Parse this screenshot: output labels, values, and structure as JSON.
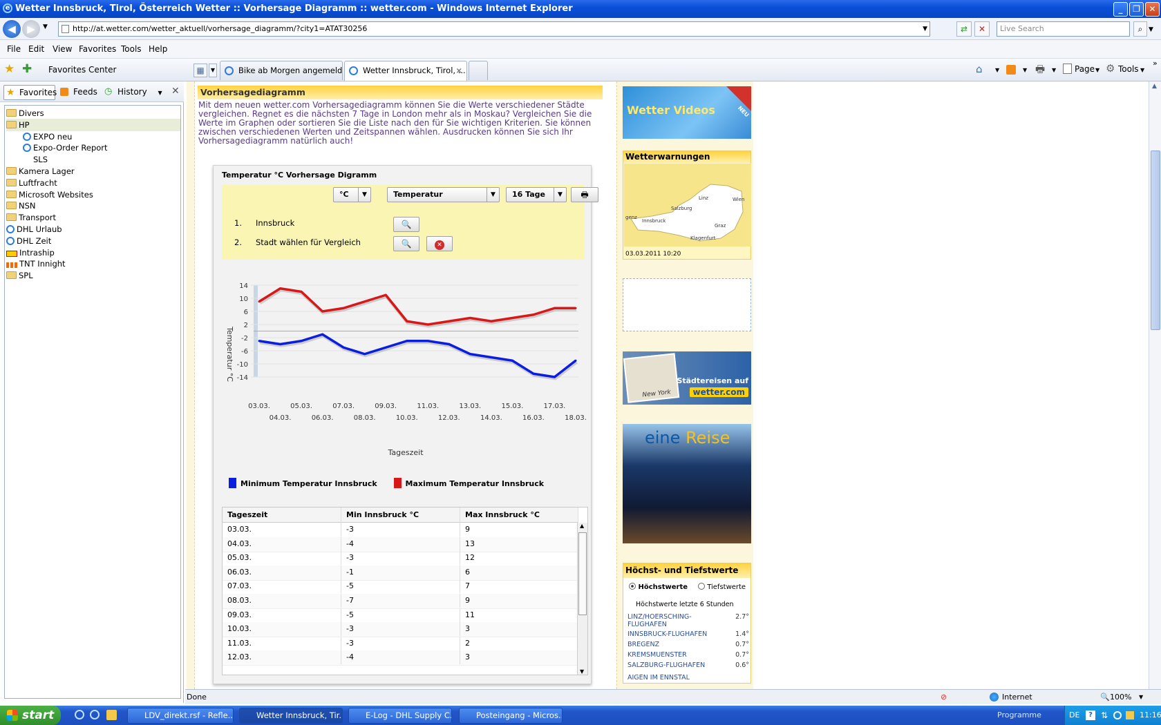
{
  "window": {
    "title": "Wetter Innsbruck, Tirol, Österreich Wetter :: Vorhersage Diagramm :: wetter.com - Windows Internet Explorer"
  },
  "address": {
    "url": "http://at.wetter.com/wetter_aktuell/vorhersage_diagramm/?city1=ATAT30256",
    "search_placeholder": "Live Search"
  },
  "menu": [
    "File",
    "Edit",
    "View",
    "Favorites",
    "Tools",
    "Help"
  ],
  "commandbar": {
    "favorites_center": "Favorites Center",
    "page": "Page",
    "tools": "Tools"
  },
  "tabs": [
    {
      "label": "Bike ab Morgen angemeldet!"
    },
    {
      "label": "Wetter Innsbruck, Tirol, ..."
    }
  ],
  "favpane": {
    "tabs": [
      "Favorites",
      "Feeds",
      "History"
    ],
    "items": [
      {
        "label": "Divers",
        "type": "folder",
        "indent": 0
      },
      {
        "label": "HP",
        "type": "folder",
        "indent": 0
      },
      {
        "label": "EXPO neu",
        "type": "link",
        "indent": 1
      },
      {
        "label": "Expo-Order Report",
        "type": "link",
        "indent": 1
      },
      {
        "label": "SLS",
        "type": "none",
        "indent": 1
      },
      {
        "label": "Kamera Lager",
        "type": "folder",
        "indent": 0
      },
      {
        "label": "Luftfracht",
        "type": "folder",
        "indent": 0
      },
      {
        "label": "Microsoft Websites",
        "type": "folder",
        "indent": 0
      },
      {
        "label": "NSN",
        "type": "folder",
        "indent": 0
      },
      {
        "label": "Transport",
        "type": "folder",
        "indent": 0
      },
      {
        "label": "DHL Urlaub",
        "type": "link",
        "indent": 0
      },
      {
        "label": "DHL Zeit",
        "type": "link",
        "indent": 0
      },
      {
        "label": "Intraship",
        "type": "dhl",
        "indent": 0
      },
      {
        "label": "TNT Innight",
        "type": "tnt",
        "indent": 0
      },
      {
        "label": "SPL",
        "type": "folder",
        "indent": 0
      }
    ]
  },
  "page": {
    "section_title": "Vorhersagediagramm",
    "intro": "Mit dem neuen wetter.com Vorhersagediagramm können Sie die Werte verschiedener Städte vergleichen. Regnet es die nächsten 7 Tage in London mehr als in Moskau? Vergleichen Sie die Werte im Graphen oder sortieren Sie die Liste nach den für Sie wichtigen Kriterien. Sie können zwischen verschiedenen Werten und Zeitspannen wählen. Ausdrucken können Sie sich Ihr Vorhersagediagramm natürlich auch!",
    "chart_box_title": "Temperatur °C Vorhersage Digramm",
    "unit_select": "°C",
    "value_select": "Temperatur",
    "range_select": "16 Tage",
    "city1_num": "1.",
    "city1": "Innsbruck",
    "city2_num": "2.",
    "city2": "Stadt wählen für Vergleich",
    "legend_min": "Minimum Temperatur Innsbruck",
    "legend_max": "Maximum Temperatur Innsbruck"
  },
  "chart_data": {
    "type": "line",
    "xlabel": "Tageszeit",
    "ylabel": "Temperatur °C",
    "ylim": [
      -14,
      14
    ],
    "yticks": [
      14,
      10,
      6,
      2,
      -2,
      -6,
      -10,
      -14
    ],
    "x": [
      "03.03.",
      "04.03.",
      "05.03.",
      "06.03.",
      "07.03.",
      "08.03.",
      "09.03.",
      "10.03.",
      "11.03.",
      "12.03.",
      "13.03.",
      "14.03.",
      "15.03.",
      "16.03.",
      "17.03.",
      "18.03."
    ],
    "series": [
      {
        "name": "Minimum Temperatur Innsbruck",
        "color": "#0a1ee0",
        "values": [
          -3,
          -4,
          -3,
          -1,
          -5,
          -7,
          -5,
          -3,
          -3,
          -4,
          -7,
          -8,
          -9,
          -13,
          -14,
          -9
        ]
      },
      {
        "name": "Maximum Temperatur Innsbruck",
        "color": "#d81818",
        "values": [
          9,
          13,
          12,
          6,
          7,
          9,
          11,
          3,
          2,
          3,
          4,
          3,
          4,
          5,
          7,
          7
        ]
      }
    ],
    "grid": true,
    "legend": "bottom"
  },
  "table": {
    "headers": [
      "Tageszeit",
      "Min Innsbruck °C",
      "Max Innsbruck °C"
    ],
    "rows": [
      [
        "03.03.",
        "-3",
        "9"
      ],
      [
        "04.03.",
        "-4",
        "13"
      ],
      [
        "05.03.",
        "-3",
        "12"
      ],
      [
        "06.03.",
        "-1",
        "6"
      ],
      [
        "07.03.",
        "-5",
        "7"
      ],
      [
        "08.03.",
        "-7",
        "9"
      ],
      [
        "09.03.",
        "-5",
        "11"
      ],
      [
        "10.03.",
        "-3",
        "3"
      ],
      [
        "11.03.",
        "-3",
        "2"
      ],
      [
        "12.03.",
        "-4",
        "3"
      ]
    ]
  },
  "sidebar": {
    "video_ad": "Wetter Videos",
    "video_badge": "NEU",
    "warnings_title": "Wetterwarnungen",
    "warnings_cities": [
      "Linz",
      "Wien",
      "Salzburg",
      "Innsbruck",
      "Graz",
      "Klagenfurt",
      "genz"
    ],
    "warnings_time": "03.03.2011 10:20",
    "city_ad_label": "Städtereisen auf",
    "city_ad_brand": "wetter.com",
    "city_ad_caption": "New York",
    "reise_ad_word1": "eine",
    "reise_ad_word2": "Reise",
    "extremes_title": "Höchst- und Tiefstwerte",
    "extremes_opt1": "Höchstwerte",
    "extremes_opt2": "Tiefstwerte",
    "extremes_sub": "Höchstwerte letzte 6 Stunden",
    "extremes": [
      {
        "station": "LINZ/HOERSCHING-FLUGHAFEN",
        "value": "2.7°"
      },
      {
        "station": "INNSBRUCK-FLUGHAFEN",
        "value": "1.4°"
      },
      {
        "station": "BREGENZ",
        "value": "0.7°"
      },
      {
        "station": "KREMSMUENSTER",
        "value": "0.7°"
      },
      {
        "station": "SALZBURG-FLUGHAFEN",
        "value": "0.6°"
      },
      {
        "station": "AIGEN IM ENNSTAL",
        "value": ""
      }
    ]
  },
  "status": {
    "text": "Done",
    "zone": "Internet",
    "zoom": "100%"
  },
  "taskbar": {
    "start": "start",
    "tasks": [
      "LDV_direkt.rsf - Refle...",
      "Wetter Innsbruck, Tir...",
      "E-Log - DHL Supply C...",
      "Posteingang - Micros..."
    ],
    "programme": "Programme",
    "lang": "DE",
    "clock": "11:16"
  }
}
